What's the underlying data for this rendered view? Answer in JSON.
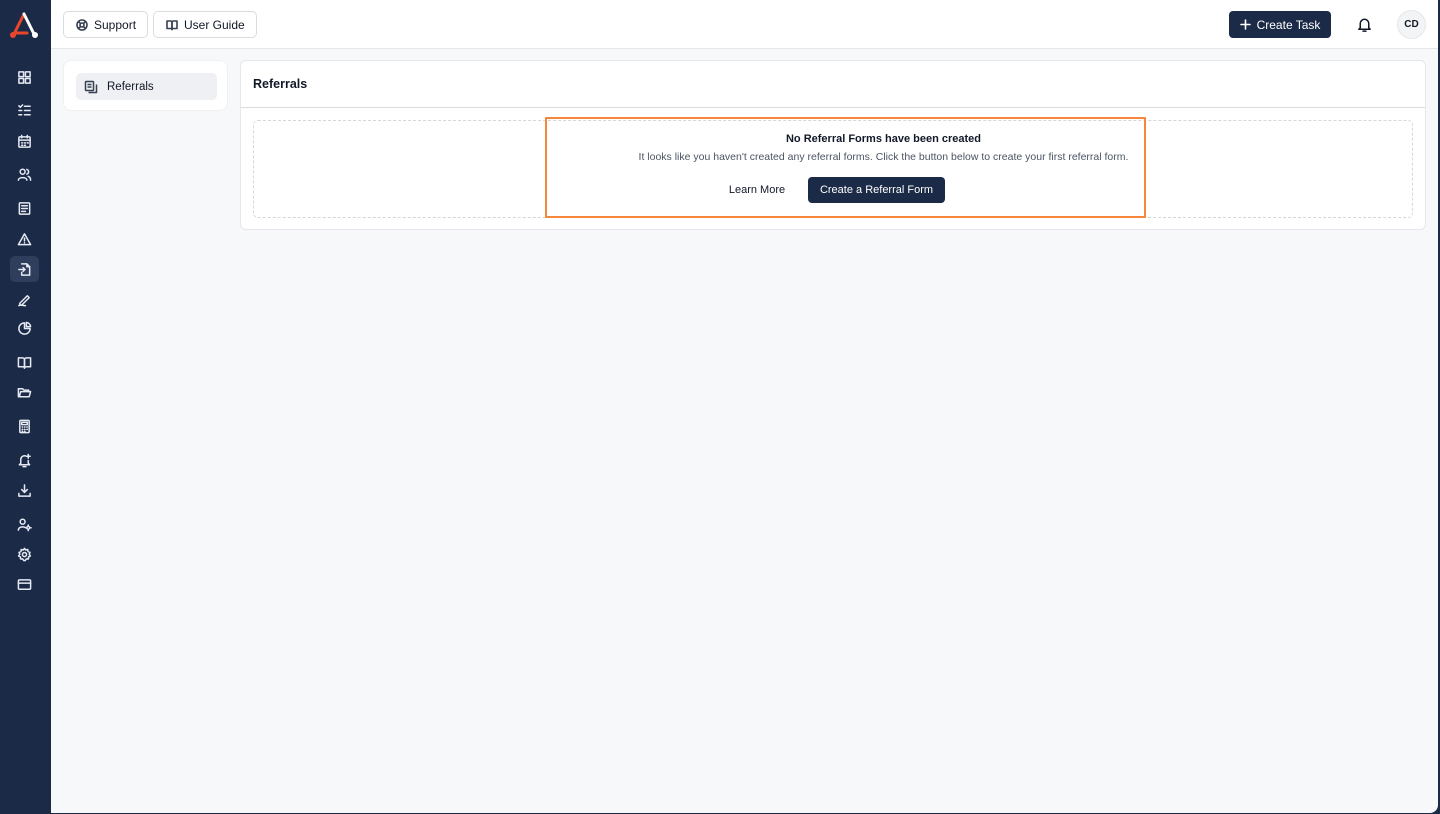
{
  "topbar": {
    "support_label": "Support",
    "user_guide_label": "User Guide",
    "create_task_label": "Create Task",
    "avatar_initials": "CD"
  },
  "subnav": {
    "items": [
      {
        "label": "Referrals",
        "icon": "copy-icon",
        "active": true
      }
    ]
  },
  "card": {
    "title": "Referrals",
    "empty_state": {
      "title": "No Referral Forms have been created",
      "description": "It looks like you haven't created any referral forms. Click the button below to create your first referral form.",
      "learn_more_label": "Learn More",
      "create_label": "Create a Referral Form"
    }
  },
  "sidebar": {
    "icons": [
      "dashboard-icon",
      "checklist-icon",
      "calendar-icon",
      "users-icon",
      "document-list-icon",
      "alert-icon",
      "referral-icon",
      "signature-icon",
      "pie-chart-icon",
      "book-icon",
      "folder-icon",
      "calculator-icon",
      "bell-plus-icon",
      "download-icon",
      "user-settings-icon",
      "settings-icon",
      "credit-card-icon"
    ],
    "active_icon": "referral-icon"
  },
  "colors": {
    "sidebar_bg": "#1b2a47",
    "primary_button": "#1b2a47",
    "highlight": "#f5863a",
    "logo_accent": "#e8472b"
  }
}
